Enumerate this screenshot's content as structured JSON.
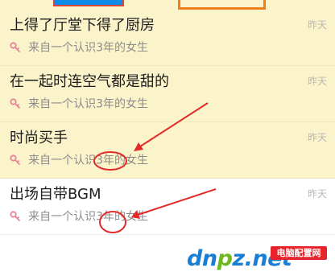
{
  "messages": [
    {
      "title": "上得了厅堂下得了厨房",
      "subtitle": "来自一个认识3年的女生",
      "time": "昨天",
      "highlighted": true
    },
    {
      "title": "在一起时连空气都是甜的",
      "subtitle": "来自一个认识3年的女生",
      "time": "昨天",
      "highlighted": true
    },
    {
      "title": "时尚买手",
      "subtitle": "来自一个认识3年的女生",
      "time": "昨天",
      "highlighted": true
    },
    {
      "title": "出场自带BGM",
      "subtitle": "来自一个认识3年的女生",
      "time": "昨天",
      "highlighted": false
    }
  ],
  "watermark": {
    "brand": "dnpz",
    "brand_main": "dn",
    "brand_accent": "p",
    "brand_tail": "z.net",
    "badge": "电脑配置网",
    "domain": "dnpz.net"
  },
  "colors": {
    "highlight_bg": "#fbf3c9",
    "annotation_red": "#e22a2a",
    "icon_pink": "#e8839a",
    "brand_blue": "#1a7fd4",
    "brand_green": "#6cba1e",
    "badge_red": "#e8242b"
  },
  "icons": {
    "subtitle_icon": "key-icon"
  }
}
